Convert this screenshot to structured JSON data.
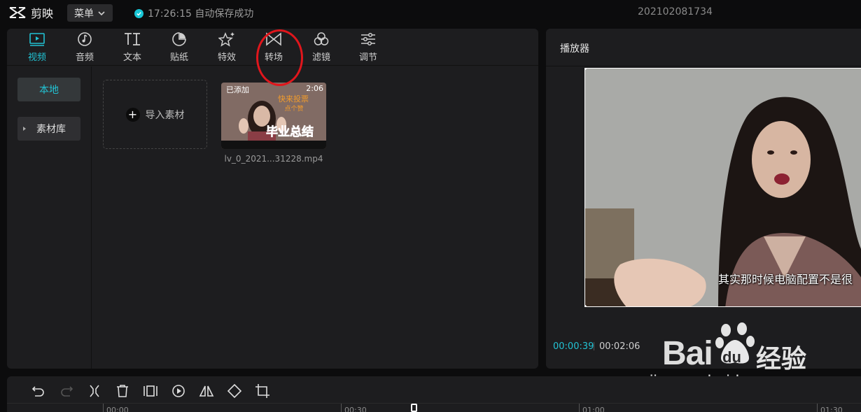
{
  "app": {
    "name": "剪映",
    "menu_label": "菜单",
    "save_status": "17:26:15 自动保存成功",
    "project_name": "202102081734"
  },
  "tabs": [
    {
      "label": "视频",
      "icon": "video-icon",
      "active": true
    },
    {
      "label": "音频",
      "icon": "music-note-icon",
      "active": false
    },
    {
      "label": "文本",
      "icon": "text-icon",
      "active": false
    },
    {
      "label": "贴纸",
      "icon": "sticker-icon",
      "active": false
    },
    {
      "label": "特效",
      "icon": "sparkle-star-icon",
      "active": false
    },
    {
      "label": "转场",
      "icon": "transition-bowtie-icon",
      "active": false
    },
    {
      "label": "滤镜",
      "icon": "filter-circles-icon",
      "active": false
    },
    {
      "label": "调节",
      "icon": "adjust-sliders-icon",
      "active": false
    }
  ],
  "sidebar": {
    "local_label": "本地",
    "library_label": "素材库"
  },
  "media": {
    "import_label": "导入素材",
    "clip": {
      "badge": "已添加",
      "duration": "2:06",
      "thumbnail_caption_top": "快来投票",
      "thumbnail_caption_mid": "点个赞",
      "thumbnail_caption_main": "毕业总结",
      "filename": "lv_0_2021...31228.mp4"
    }
  },
  "player": {
    "title": "播放器",
    "subtitle": "其实那时候电脑配置不是很",
    "current_time": "00:00:39",
    "total_time": "00:02:06"
  },
  "timeline": {
    "ticks": [
      "00:00",
      "00:30",
      "01:00",
      "01:30"
    ],
    "tools": [
      "undo-icon",
      "redo-icon",
      "split-icon",
      "delete-icon",
      "freeze-frame-icon",
      "reverse-play-icon",
      "mirror-icon",
      "rotate-icon",
      "crop-icon"
    ]
  },
  "watermark": {
    "bai": "Bai",
    "du": "du",
    "jingyan": "经验",
    "url": "jingyan.baidu.com"
  },
  "colors": {
    "accent": "#22c2d3",
    "panel": "#1d1d1f",
    "background": "#0c0c0d",
    "annotation": "#e0161c"
  }
}
